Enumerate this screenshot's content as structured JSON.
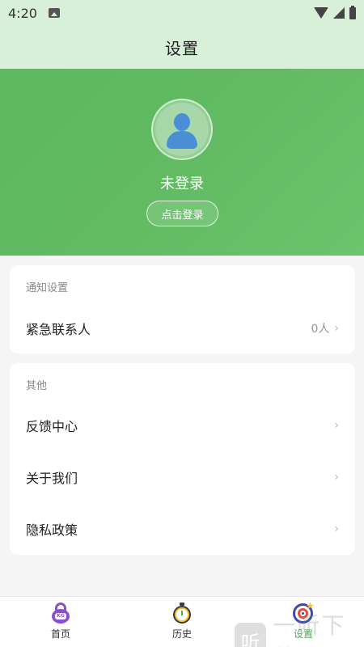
{
  "status_bar": {
    "time": "4:20"
  },
  "header": {
    "title": "设置"
  },
  "profile": {
    "login_status": "未登录",
    "login_button": "点击登录"
  },
  "notify_card": {
    "section_title": "通知设置",
    "items": [
      {
        "label": "紧急联系人",
        "value": "0人"
      }
    ]
  },
  "other_card": {
    "section_title": "其他",
    "items": [
      {
        "label": "反馈中心"
      },
      {
        "label": "关于我们"
      },
      {
        "label": "隐私政策"
      }
    ]
  },
  "bottom_nav": {
    "items": [
      {
        "label": "首页",
        "icon": "kettlebell-icon",
        "active": false
      },
      {
        "label": "历史",
        "icon": "stopwatch-icon",
        "active": false
      },
      {
        "label": "设置",
        "icon": "target-icon",
        "active": true
      }
    ]
  },
  "watermark": {
    "logo_text": "听",
    "text": "一听下载"
  },
  "colors": {
    "header_bg": "#d8efd9",
    "profile_green": "#62bb63",
    "active_tab": "#4caf50"
  }
}
